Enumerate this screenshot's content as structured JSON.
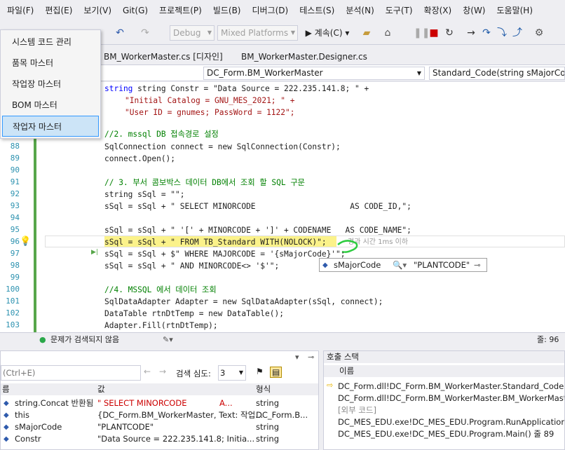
{
  "menu": [
    "파일(F)",
    "편집(E)",
    "보기(V)",
    "Git(G)",
    "프로젝트(P)",
    "빌드(B)",
    "디버그(D)",
    "테스트(S)",
    "분석(N)",
    "도구(T)",
    "확장(X)",
    "창(W)",
    "도움말(H)"
  ],
  "toolbar": {
    "config": "Debug",
    "platform": "Mixed Platforms",
    "continue": "▶ 계속(C) ▾"
  },
  "dropdown": [
    "시스템 코드 관리",
    "품목 마스터",
    "작업장 마스터",
    "BOM 마스터",
    "작업자 마스터"
  ],
  "tabs": [
    "BM_WorkerMaster.cs [디자인]",
    "BM_WorkerMaster.Designer.cs"
  ],
  "nav": {
    "class": "DC_Form.BM_WorkerMaster",
    "method": "Standard_Code(string sMajorCode)"
  },
  "line_numbers": [
    "88",
    "89",
    "90",
    "91",
    "92",
    "93",
    "94",
    "95",
    "96",
    "97",
    "98",
    "99",
    "100",
    "101",
    "102",
    "103"
  ],
  "code": {
    "l1": "string Constr = \"Data Source = 222.235.141.8; \" +",
    "l2": "\"Initial Catalog = GNU_MES_2021; \" +",
    "l3": "\"User ID = gnumes; PassWord = 1122\";",
    "c2": "//2. mssql DB 접속경로 설정",
    "c88": "SqlConnection connect = new SqlConnection(Constr);",
    "c89": "connect.Open();",
    "c91": "// 3. 부서 콤보박스 데이터 DB에서 조회 할 SQL 구문",
    "c92": "string sSql = \"\";",
    "c93": "sSql = sSql + \" SELECT MINORCODE                    AS CODE_ID,\";",
    "c95": "sSql = sSql + \" '[' + MINORCODE + ']' + CODENAME   AS CODE_NAME\";",
    "c96": "sSql = sSql + \" FROM TB_Standard WITH(NOLOCK)\";",
    "c96b": "경과 시간 1ms 이하",
    "c97": "sSql = sSql + $\" WHERE MAJORCODE = '{sMajorCode}'\";",
    "c98": "sSql = sSql + \" AND MINORCODE<> '$'\";",
    "c100": "//4. MSSQL 에서 데이터 조회",
    "c101": "SqlDataAdapter Adapter = new SqlDataAdapter(sSql, connect);",
    "c102": "DataTable rtnDtTemp = new DataTable();",
    "c103": "Adapter.Fill(rtnDtTemp);"
  },
  "datatip": {
    "name": "sMajorCode",
    "value": "\"PLANTCODE\""
  },
  "status": {
    "issues": "문제가 검색되지 않음",
    "line": "줄: 96"
  },
  "locals": {
    "search_placeholder": "(Ctrl+E)",
    "depth_label": "검색 심도:",
    "depth": "3",
    "headers": [
      "름",
      "값",
      "형식"
    ],
    "rows": [
      {
        "name": "string.Concat 반환됨",
        "value": "\" SELECT MINORCODE",
        "flag": "A...",
        "type": "string"
      },
      {
        "name": "this",
        "value": "{DC_Form.BM_WorkerMaster, Text: 작업...",
        "flag": "",
        "type": "DC_Form.B..."
      },
      {
        "name": "sMajorCode",
        "value": "\"PLANTCODE\"",
        "flag": "",
        "type": "string"
      },
      {
        "name": "Constr",
        "value": "\"Data Source = 222.235.141.8; Initia...",
        "flag": "",
        "type": "string"
      }
    ]
  },
  "callstack": {
    "title": "호출 스택",
    "header": "이름",
    "rows": [
      "DC_Form.dll!DC_Form.BM_WorkerMaster.Standard_Code(strin",
      "DC_Form.dll!DC_Form.BM_WorkerMaster.BM_WorkerMaster_l",
      "[외부 코드]",
      "DC_MES_EDU.exe!DC_MES_EDU.Program.RunApplication(obje",
      "DC_MES_EDU.exe!DC_MES_EDU.Program.Main() 줄 89"
    ]
  }
}
